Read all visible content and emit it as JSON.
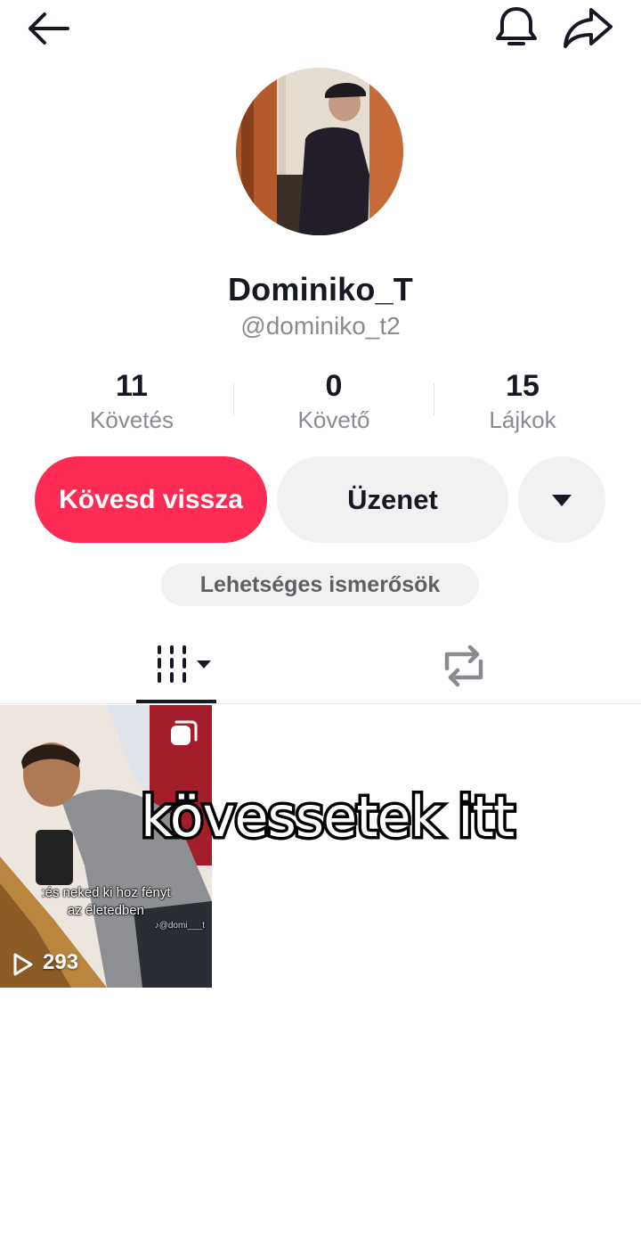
{
  "header": {
    "back_icon": "arrow-left-icon",
    "bell_icon": "bell-icon",
    "share_icon": "share-arrow-icon"
  },
  "profile": {
    "display_name": "Dominiko_T",
    "username": "@dominiko_t2"
  },
  "stats": [
    {
      "value": "11",
      "label": "Követés"
    },
    {
      "value": "0",
      "label": "Követő"
    },
    {
      "value": "15",
      "label": "Lájkok"
    }
  ],
  "actions": {
    "follow_back_label": "Kövesd vissza",
    "message_label": "Üzenet",
    "more_icon": "caret-down-icon",
    "suggestions_label": "Lehetséges ismerősök"
  },
  "tabs": {
    "videos_icon": "grid-icon",
    "reposts_icon": "repost-icon"
  },
  "videos": [
    {
      "caption_line1": ":és neked ki hoz fényt",
      "caption_line2": "az életedben",
      "views": "293",
      "watermark": "♪@domi___t"
    }
  ],
  "overlay": {
    "text": "kövessetek itt"
  },
  "colors": {
    "accent": "#fe2c55",
    "secondary_button": "#f1f1f2",
    "muted_text": "#8a8b91"
  }
}
